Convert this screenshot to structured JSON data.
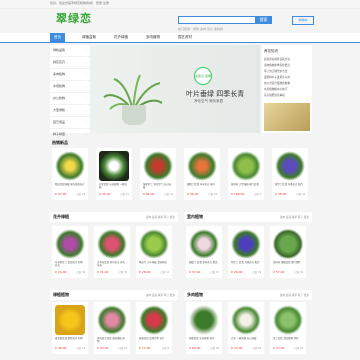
{
  "topbar": {
    "text": "您好，欢迎光临翠绿恋植物商城！ 登录 注册"
  },
  "logo": "翠绿恋",
  "search": {
    "placeholder": "",
    "button": "搜索",
    "hot": "热门搜索：绿萝 多肉 吊兰 发财树"
  },
  "cart": "购物车",
  "nav": [
    "首页",
    "绿植盆栽",
    "花卉绿植",
    "多肉植物",
    "园艺资材"
  ],
  "categories": [
    "绿植盆栽",
    "鲜花花卉",
    "多肉植物",
    "水培植物",
    "办公植物",
    "大型绿植",
    "园艺用品",
    "种子种苗"
  ],
  "banner": {
    "badge": "虎皮兰·四季",
    "headline": "叶片垂绿 四季长青",
    "sub": "净化空气 美化家居"
  },
  "news": {
    "title": "养花知识",
    "items": [
      "如何养好绿萝盆栽方法",
      "多肉植物夏季养护要点",
      "吊兰的正确浇水方法",
      "发财树叶子发黄怎么办",
      "办公室适合摆放的植物",
      "水培植物换水小技巧",
      "花卉施肥注意事项"
    ]
  },
  "sections": [
    {
      "title": "热销新品",
      "links": ""
    },
    {
      "title": "花卉绿植",
      "links": "多肉  盆栽  绿萝  吊兰  更多"
    },
    {
      "title": "室内植物",
      "links": "多肉  盆栽  绿萝  吊兰  更多"
    },
    {
      "title": "绿植植物",
      "links": "多肉  盆栽  绿萝  吊兰  更多"
    },
    {
      "title": "多肉植物",
      "links": "多肉  盆栽  绿萝  吊兰  更多"
    }
  ],
  "row1": [
    {
      "desc": "精品盆栽绿植 室内桌面花卉",
      "price": "¥ 37.00",
      "sold": "已售 23"
    },
    {
      "desc": "白掌盆栽 水培植物 一帆风顺",
      "price": "¥ 45.00",
      "sold": "已售 15"
    },
    {
      "desc": "绿萝吊兰 净化空气 办公绿植",
      "price": "¥ 66.00",
      "sold": "已售 31"
    },
    {
      "desc": "蝴蝶兰盆栽 年宵花卉 室内",
      "price": "¥ 39.00",
      "sold": "已售 18"
    },
    {
      "desc": "发财树 大型绿植 客厅盆栽",
      "price": "¥ 108.00",
      "sold": "已售 9"
    },
    {
      "desc": "紫罗兰盆栽 芳香花卉 阳台",
      "price": "¥ 38.00",
      "sold": "已售 42"
    }
  ],
  "row2a": [
    {
      "desc": "非洲紫罗兰 盆栽花卉 四季开花",
      "price": "¥ 24.00",
      "sold": "已售 56"
    },
    {
      "desc": "长寿花盆栽 室内花卉 多色可选",
      "price": "¥ 21.00",
      "sold": "已售 33"
    },
    {
      "desc": "龟背竹 大叶绿植 北欧风格",
      "price": "¥ 28.00",
      "sold": "已售 12"
    }
  ],
  "row2b": [
    {
      "desc": "蝴蝶兰 盆栽 室内花卉 精品",
      "price": "¥ 37.00",
      "sold": "已售 27"
    },
    {
      "desc": "紫罗兰 盆栽 芳香花卉 阳台",
      "price": "¥ 29.00",
      "sold": "已售 19"
    },
    {
      "desc": "发财树 绿植盆栽 客厅摆件",
      "price": "¥ 57.00",
      "sold": "已售 44"
    }
  ],
  "row3a": [
    {
      "desc": "黄金菊盆栽 庭院花卉 四季",
      "price": "¥ 46.00",
      "sold": "已售 14"
    },
    {
      "desc": "多肉组合盆栽 桌面绿植 萌物",
      "price": "¥ 33.00",
      "sold": "已售 21"
    },
    {
      "desc": "玫瑰花苗 盆栽月季 花卉",
      "price": "¥ 77.00",
      "sold": "已售 8"
    }
  ],
  "row3b": [
    {
      "desc": "绿萝盆栽 水培植物 室内",
      "price": "¥ 64.00",
      "sold": "已售 36"
    },
    {
      "desc": "白掌 一帆风顺 办公绿植",
      "price": "¥ 24.00",
      "sold": "已售 50"
    },
    {
      "desc": "吊兰盆栽 悬挂植物 净化",
      "price": "¥ 77.00",
      "sold": "已售 22"
    }
  ]
}
